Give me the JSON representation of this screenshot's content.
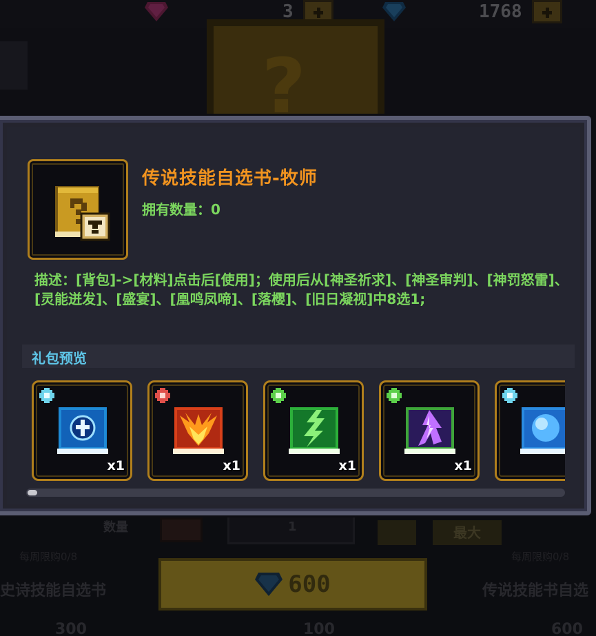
{
  "background": {
    "currency_1": {
      "value": "3",
      "gem": "pink-gem-icon"
    },
    "currency_2": {
      "value": "1768",
      "gem": "blue-gem-icon"
    },
    "qty_label": "数量",
    "qty_value": "1",
    "max_label": "最大",
    "weekly_limit_left": "每周限购0/8",
    "weekly_limit_right": "每周限购0/8",
    "left_item_name": "史诗技能自选书",
    "right_item_name": "传说技能书自选",
    "buy_price": "600",
    "bottom_price_left": "300",
    "bottom_price_mid": "100",
    "bottom_price_right": "600"
  },
  "popup": {
    "item_title": "传说技能自选书-牧师",
    "owned_label": "拥有数量：0",
    "description": "描述：[背包]->[材料]点击后[使用]；使用后从[神圣祈求]、[神圣审判]、[神罚怒雷]、[灵能迸发]、[盛宴]、[凰鸣凤啼]、[落樱]、[旧日凝视]中8选1;",
    "preview_title": "礼包预览",
    "slots": [
      {
        "rarity": "cyan",
        "book": "holy-cross-book-icon",
        "qty": "x1"
      },
      {
        "rarity": "red",
        "book": "fire-wings-book-icon",
        "qty": "x1"
      },
      {
        "rarity": "green",
        "book": "green-lightning-book-icon",
        "qty": "x1"
      },
      {
        "rarity": "green",
        "book": "purple-thunder-book-icon",
        "qty": "x1"
      },
      {
        "rarity": "cyan",
        "book": "blue-orb-book-icon",
        "qty": ""
      }
    ],
    "scroll_position": 0
  },
  "colors": {
    "title_orange": "#f2941f",
    "text_green": "#7bd65e",
    "preview_cyan": "#5fc6e8",
    "gold_border": "#b07f1c"
  }
}
